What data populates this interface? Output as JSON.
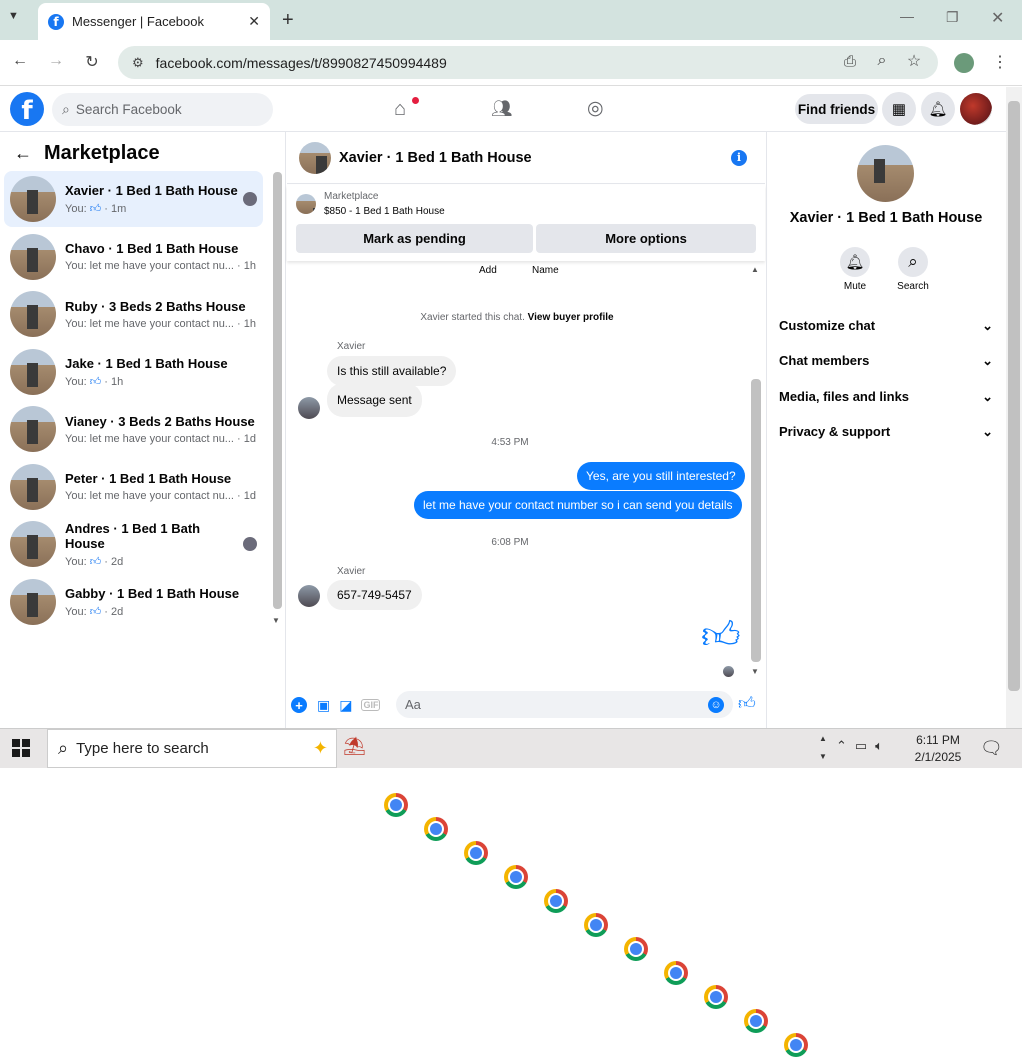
{
  "browser": {
    "tab_title": "Messenger | Facebook",
    "url": "facebook.com/messages/t/8990827450994489"
  },
  "fb": {
    "search_placeholder": "Search Facebook",
    "find_friends": "Find friends"
  },
  "left": {
    "title": "Marketplace",
    "conversations": [
      {
        "name": "Xavier · 1 Bed 1 Bath House",
        "preview": "You:",
        "thumb": true,
        "time": "1m",
        "active": true,
        "seen_avatar": true
      },
      {
        "name": "Chavo · 1 Bed 1 Bath House",
        "preview": "You: let me have your contact nu...",
        "time": "1h"
      },
      {
        "name": "Ruby · 3 Beds 2 Baths House",
        "preview": "You: let me have your contact nu...",
        "time": "1h"
      },
      {
        "name": "Jake · 1 Bed 1 Bath House",
        "preview": "You:",
        "thumb": true,
        "time": "1h"
      },
      {
        "name": "Vianey · 3 Beds 2 Baths House",
        "preview": "You: let me have your contact nu...",
        "time": "1d"
      },
      {
        "name": "Peter · 1 Bed 1 Bath House",
        "preview": "You: let me have your contact nu...",
        "time": "1d"
      },
      {
        "name": "Andres · 1 Bed 1 Bath House",
        "preview": "You:",
        "thumb": true,
        "time": "2d",
        "seen_avatar": true
      },
      {
        "name": "Gabby · 1 Bed 1 Bath House",
        "preview": "You:",
        "thumb": true,
        "time": "2d"
      }
    ]
  },
  "chat": {
    "title": "Xavier · 1 Bed 1 Bath House",
    "marketplace_label": "Marketplace",
    "listing": "$850 - 1 Bed 1 Bath House",
    "mark_pending": "Mark as pending",
    "more_options": "More options",
    "add_label": "Add",
    "name_label": "Name",
    "started_text": "Xavier started this chat.",
    "buyer_profile_link": "View buyer profile",
    "sender1": "Xavier",
    "msg1": "Is this still available?",
    "msg2": "Message sent",
    "time1": "4:53 PM",
    "out1": "Yes, are you still interested?",
    "out2": "let me have your contact number so i can send you details",
    "time2": "6:08 PM",
    "sender2": "Xavier",
    "msg3": "657-749-5457",
    "composer_placeholder": "Aa"
  },
  "right": {
    "name": "Xavier · 1 Bed 1 Bath House",
    "mute": "Mute",
    "search": "Search",
    "rows": [
      "Customize chat",
      "Chat members",
      "Media, files and links",
      "Privacy & support"
    ]
  },
  "taskbar": {
    "search_placeholder": "Type here to search",
    "time": "6:11 PM",
    "date": "2/1/2025"
  },
  "colors": {
    "fb_blue": "#1877f2",
    "messenger_blue": "#0a7cff",
    "active_row": "#e7f0fd"
  }
}
